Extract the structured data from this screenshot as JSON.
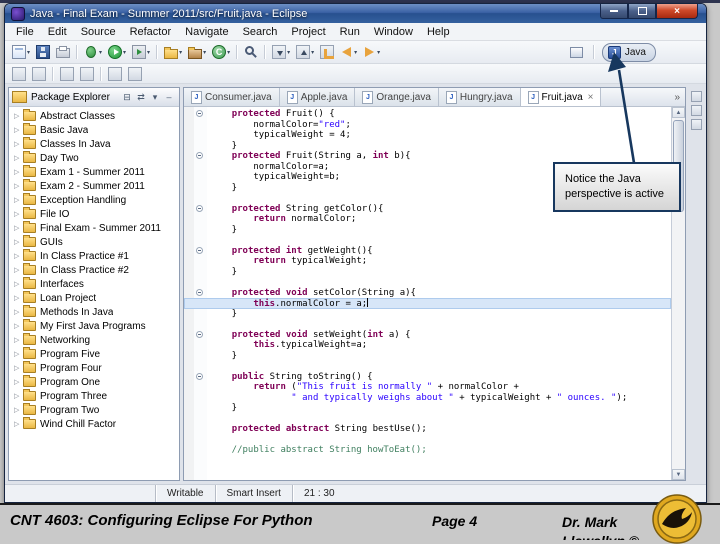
{
  "window": {
    "title": "Java - Final Exam - Summer 2011/src/Fruit.java - Eclipse"
  },
  "menu": {
    "items": [
      "File",
      "Edit",
      "Source",
      "Refactor",
      "Navigate",
      "Search",
      "Project",
      "Run",
      "Window",
      "Help"
    ]
  },
  "toolbar": {
    "row1": [
      {
        "name": "new-wizard-icon",
        "kind": "new",
        "dd": true
      },
      {
        "name": "save-icon",
        "kind": "save"
      },
      {
        "name": "print-icon",
        "kind": "print"
      },
      {
        "sep": true
      },
      {
        "name": "debug-icon",
        "kind": "debug",
        "dd": true
      },
      {
        "name": "run-icon",
        "kind": "run",
        "dd": true
      },
      {
        "name": "run-external-tools-icon",
        "kind": "runx",
        "dd": true
      },
      {
        "sep": true
      },
      {
        "name": "new-java-project-icon",
        "kind": "jproject",
        "dd": true
      },
      {
        "name": "new-java-package-icon",
        "kind": "jpackage",
        "dd": true
      },
      {
        "name": "new-java-class-icon",
        "kind": "jclass",
        "dd": true
      },
      {
        "sep": true
      },
      {
        "name": "search-icon",
        "kind": "search"
      },
      {
        "sep": true
      },
      {
        "name": "next-annotation-icon",
        "kind": "annotdown",
        "dd": true
      },
      {
        "name": "previous-annotation-icon",
        "kind": "annotup",
        "dd": true
      },
      {
        "name": "last-edit-location-icon",
        "kind": "lastedit"
      },
      {
        "name": "back-icon",
        "kind": "back",
        "dd": true
      },
      {
        "name": "forward-icon",
        "kind": "forward",
        "dd": true
      }
    ],
    "row2": [
      {
        "name": "java-browsing-icon",
        "kind": "gen"
      },
      {
        "name": "open-type-icon",
        "kind": "gen"
      },
      {
        "sep": true
      },
      {
        "name": "toggle-mark-occurrences-icon",
        "kind": "gen"
      },
      {
        "name": "toggle-block-selection-icon",
        "kind": "gen"
      },
      {
        "sep": true
      },
      {
        "name": "show-whitespace-icon",
        "kind": "gen"
      },
      {
        "name": "word-wrap-icon",
        "kind": "gen"
      }
    ],
    "perspective": {
      "label": "Java"
    }
  },
  "package_explorer": {
    "title": "Package Explorer",
    "header_icons": [
      "collapse-all-icon",
      "link-with-editor-icon",
      "view-menu-icon",
      "minimize-view-icon"
    ],
    "header_glyphs": [
      "⊟",
      "⇄",
      "▾",
      "–"
    ],
    "items": [
      "Abstract Classes",
      "Basic Java",
      "Classes In Java",
      "Day Two",
      "Exam 1 - Summer 2011",
      "Exam 2 - Summer 2011",
      "Exception Handling",
      "File IO",
      "Final Exam - Summer 2011",
      "GUIs",
      "In Class Practice #1",
      "In Class Practice #2",
      "Interfaces",
      "Loan Project",
      "Methods In Java",
      "My First Java Programs",
      "Networking",
      "Program Five",
      "Program Four",
      "Program One",
      "Program Three",
      "Program Two",
      "Wind Chill Factor"
    ]
  },
  "editor": {
    "tabs": [
      {
        "label": "Consumer.java",
        "active": false
      },
      {
        "label": "Apple.java",
        "active": false
      },
      {
        "label": "Orange.java",
        "active": false
      },
      {
        "label": "Hungry.java",
        "active": false
      },
      {
        "label": "Fruit.java",
        "active": true
      }
    ],
    "overflow": "»",
    "code": [
      {
        "fold": true,
        "t": [
          [
            "p",
            "    "
          ],
          [
            "k",
            "protected"
          ],
          [
            "p",
            " Fruit() {"
          ]
        ]
      },
      {
        "t": [
          [
            "p",
            "        normalColor="
          ],
          [
            "s",
            "\"red\""
          ],
          [
            "p",
            ";"
          ]
        ]
      },
      {
        "t": [
          [
            "p",
            "        typicalWeight = 4;"
          ]
        ]
      },
      {
        "t": [
          [
            "p",
            "    }"
          ]
        ]
      },
      {
        "fold": true,
        "t": [
          [
            "p",
            "    "
          ],
          [
            "k",
            "protected"
          ],
          [
            "p",
            " Fruit(String a, "
          ],
          [
            "k",
            "int"
          ],
          [
            "p",
            " b){"
          ]
        ]
      },
      {
        "t": [
          [
            "p",
            "        normalColor=a;"
          ]
        ]
      },
      {
        "t": [
          [
            "p",
            "        typicalWeight=b;"
          ]
        ]
      },
      {
        "t": [
          [
            "p",
            "    }"
          ]
        ]
      },
      {
        "t": [
          [
            "p",
            ""
          ]
        ]
      },
      {
        "fold": true,
        "t": [
          [
            "p",
            "    "
          ],
          [
            "k",
            "protected"
          ],
          [
            "p",
            " String getColor(){"
          ]
        ]
      },
      {
        "t": [
          [
            "p",
            "        "
          ],
          [
            "k",
            "return"
          ],
          [
            "p",
            " normalColor;"
          ]
        ]
      },
      {
        "t": [
          [
            "p",
            "    }"
          ]
        ]
      },
      {
        "t": [
          [
            "p",
            ""
          ]
        ]
      },
      {
        "fold": true,
        "t": [
          [
            "p",
            "    "
          ],
          [
            "k",
            "protected"
          ],
          [
            "p",
            " "
          ],
          [
            "k",
            "int"
          ],
          [
            "p",
            " getWeight(){"
          ]
        ]
      },
      {
        "t": [
          [
            "p",
            "        "
          ],
          [
            "k",
            "return"
          ],
          [
            "p",
            " typicalWeight;"
          ]
        ]
      },
      {
        "t": [
          [
            "p",
            "    }"
          ]
        ]
      },
      {
        "t": [
          [
            "p",
            ""
          ]
        ]
      },
      {
        "fold": true,
        "t": [
          [
            "p",
            "    "
          ],
          [
            "k",
            "protected"
          ],
          [
            "p",
            " "
          ],
          [
            "k",
            "void"
          ],
          [
            "p",
            " setColor(String a){"
          ]
        ]
      },
      {
        "hl": true,
        "caret": true,
        "t": [
          [
            "p",
            "        "
          ],
          [
            "k",
            "this"
          ],
          [
            "p",
            ".normalColor = a;"
          ]
        ]
      },
      {
        "t": [
          [
            "p",
            "    }"
          ]
        ]
      },
      {
        "t": [
          [
            "p",
            ""
          ]
        ]
      },
      {
        "fold": true,
        "t": [
          [
            "p",
            "    "
          ],
          [
            "k",
            "protected"
          ],
          [
            "p",
            " "
          ],
          [
            "k",
            "void"
          ],
          [
            "p",
            " setWeight("
          ],
          [
            "k",
            "int"
          ],
          [
            "p",
            " a) {"
          ]
        ]
      },
      {
        "t": [
          [
            "p",
            "        "
          ],
          [
            "k",
            "this"
          ],
          [
            "p",
            ".typicalWeight=a;"
          ]
        ]
      },
      {
        "t": [
          [
            "p",
            "    }"
          ]
        ]
      },
      {
        "t": [
          [
            "p",
            ""
          ]
        ]
      },
      {
        "fold": true,
        "t": [
          [
            "p",
            "    "
          ],
          [
            "k",
            "public"
          ],
          [
            "p",
            " String toString() {"
          ]
        ]
      },
      {
        "t": [
          [
            "p",
            "        "
          ],
          [
            "k",
            "return"
          ],
          [
            "p",
            " ("
          ],
          [
            "s",
            "\"This fruit is normally \""
          ],
          [
            "p",
            " + normalColor + "
          ]
        ]
      },
      {
        "t": [
          [
            "p",
            "               "
          ],
          [
            "s",
            "\" and typically weighs about \""
          ],
          [
            "p",
            " + typicalWeight + "
          ],
          [
            "s",
            "\" ounces. \""
          ],
          [
            "p",
            ");"
          ]
        ]
      },
      {
        "t": [
          [
            "p",
            "    }"
          ]
        ]
      },
      {
        "t": [
          [
            "p",
            ""
          ]
        ]
      },
      {
        "t": [
          [
            "p",
            "    "
          ],
          [
            "k",
            "protected"
          ],
          [
            "p",
            " "
          ],
          [
            "k",
            "abstract"
          ],
          [
            "p",
            " String bestUse();"
          ]
        ]
      },
      {
        "t": [
          [
            "p",
            ""
          ]
        ]
      },
      {
        "t": [
          [
            "c",
            "    //public abstract String howToEat();"
          ]
        ]
      }
    ]
  },
  "right_trim_icons": [
    "outline-view-icon",
    "task-list-view-icon",
    "problems-view-icon"
  ],
  "status": {
    "writable": "Writable",
    "insert_mode": "Smart Insert",
    "cursor_position": "21 : 30"
  },
  "annotation": {
    "callout": "Notice the Java perspective is active"
  },
  "footer": {
    "course": "CNT 4603: Configuring Eclipse For Python",
    "page": "Page 4",
    "author": "Dr. Mark Llewellyn ©"
  },
  "colors": {
    "keyword": "#7f0055",
    "string": "#2a00ff",
    "comment": "#3f7f5f",
    "callout_border": "#17375e",
    "titlebar_blue": "#3b62a5",
    "logo_gold": "#e0a81f"
  }
}
